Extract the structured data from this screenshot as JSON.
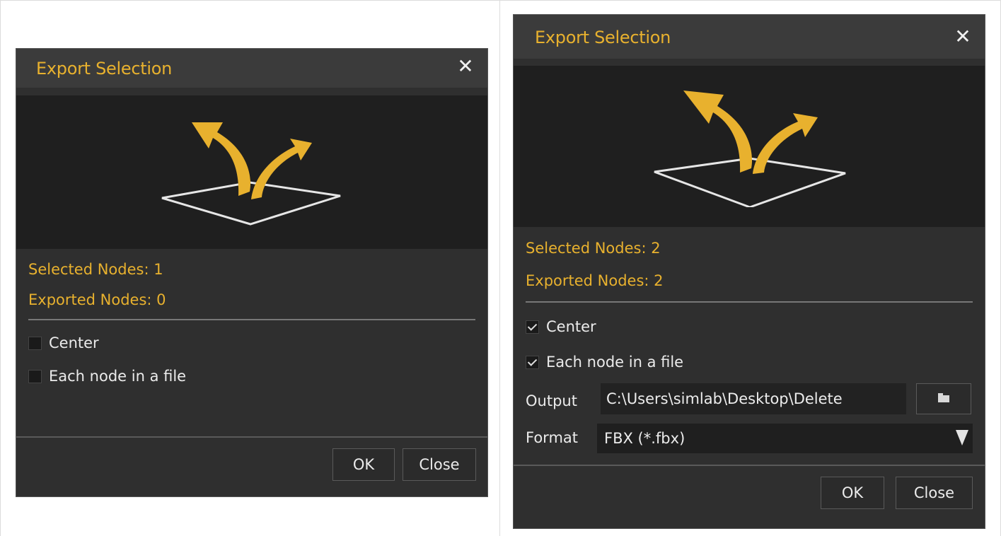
{
  "left_dialog": {
    "title": "Export Selection",
    "close_glyph": "✕",
    "selected_nodes": "Selected Nodes: 1",
    "exported_nodes": "Exported Nodes: 0",
    "options": [
      {
        "label": "Center",
        "checked": false
      },
      {
        "label": "Each node in a file",
        "checked": false
      }
    ],
    "ok_label": "OK",
    "close_label": "Close"
  },
  "right_dialog": {
    "title": "Export Selection",
    "close_glyph": "✕",
    "selected_nodes": "Selected Nodes: 2",
    "exported_nodes": "Exported Nodes: 2",
    "options": [
      {
        "label": "Center",
        "checked": true
      },
      {
        "label": "Each node in a file",
        "checked": true
      }
    ],
    "output_label": "Output",
    "output_value": "C:\\Users\\simlab\\Desktop\\Delete",
    "format_label": "Format",
    "format_value": "FBX (*.fbx)",
    "ok_label": "OK",
    "close_label": "Close"
  },
  "colors": {
    "accent": "#e8b12e",
    "dialog_bg": "#2f2f2f",
    "titlebar_bg": "#3b3b3b",
    "preview_bg": "#1f1f1f"
  },
  "icons": {
    "close": "close-icon",
    "export_preview": "export-arrows-icon",
    "browse": "folder-icon",
    "dropdown": "dropdown-arrow-icon",
    "checkmark": "checkmark-icon"
  }
}
